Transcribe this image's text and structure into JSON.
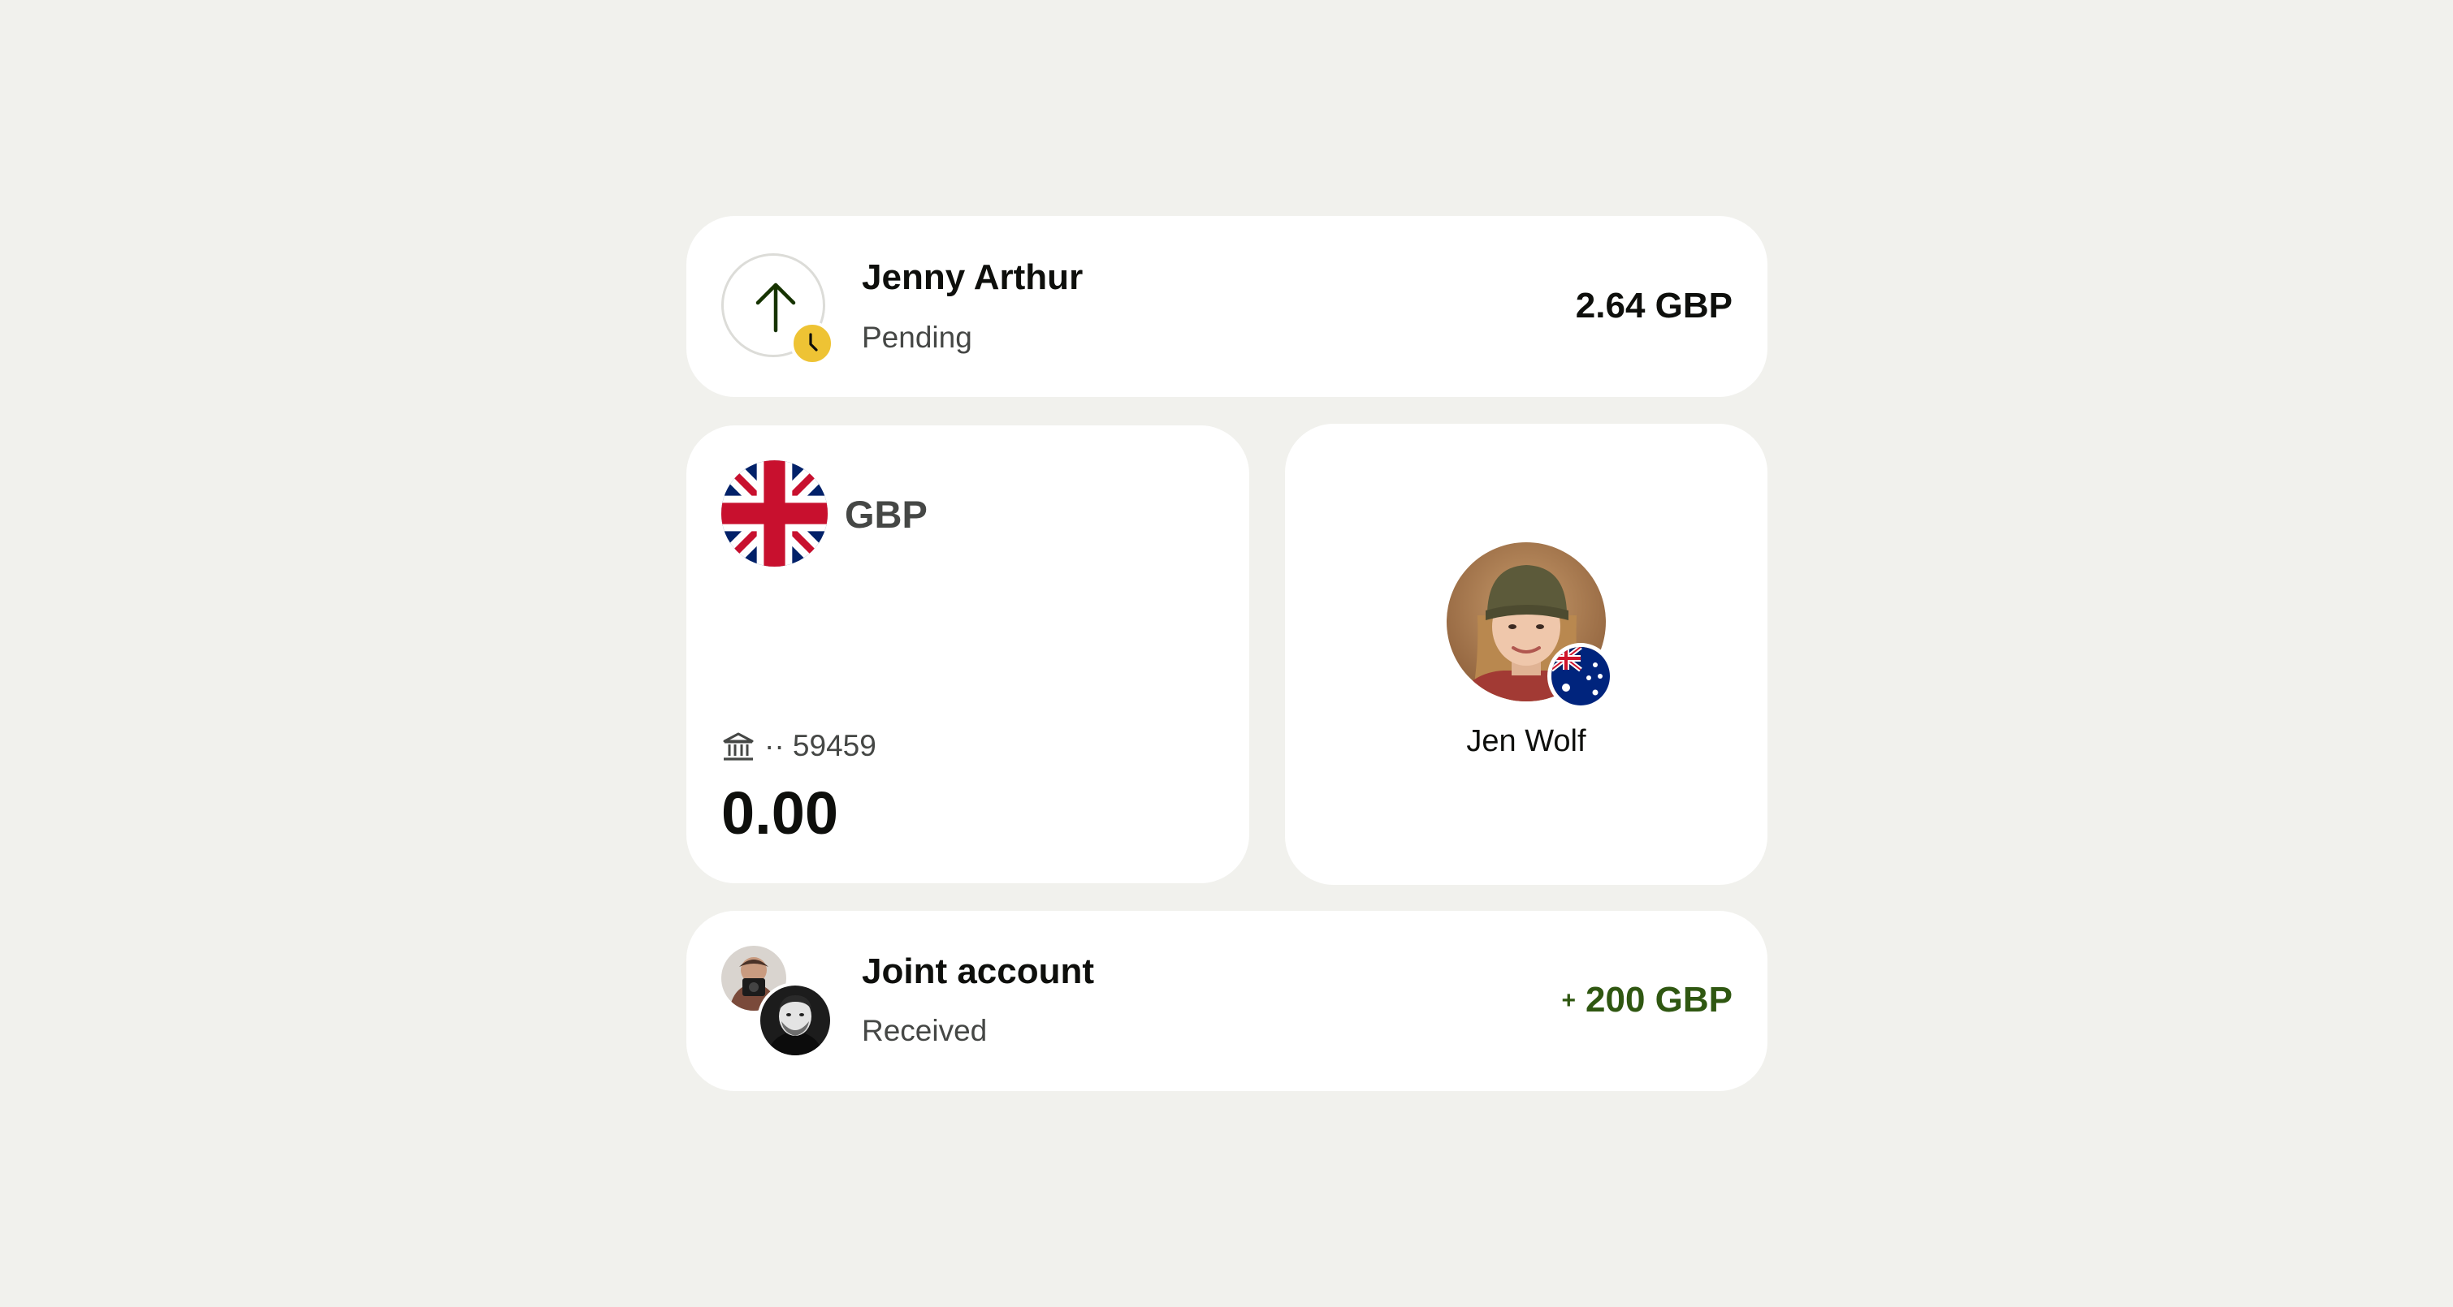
{
  "pending_transfer": {
    "name": "Jenny Arthur",
    "status": "Pending",
    "amount": "2.64 GBP",
    "icon": "arrow-up-icon",
    "badge_icon": "clock-icon",
    "badge_color": "#eec334"
  },
  "gbp_account": {
    "currency_code": "GBP",
    "flag_icon": "uk-flag-icon",
    "bank_icon": "bank-icon",
    "account_number": "·· 59459",
    "balance": "0.00"
  },
  "contact": {
    "name": "Jen Wolf",
    "flag_icon": "australia-flag-icon"
  },
  "joint_account": {
    "name": "Joint account",
    "status": "Received",
    "amount_prefix": "+",
    "amount": "200 GBP",
    "amount_color": "#2f5711"
  },
  "colors": {
    "background": "#f1f1ed",
    "card": "#ffffff",
    "text_primary": "#0e0f0c",
    "text_secondary": "#454745",
    "positive": "#2f5711",
    "pending": "#eec334"
  }
}
